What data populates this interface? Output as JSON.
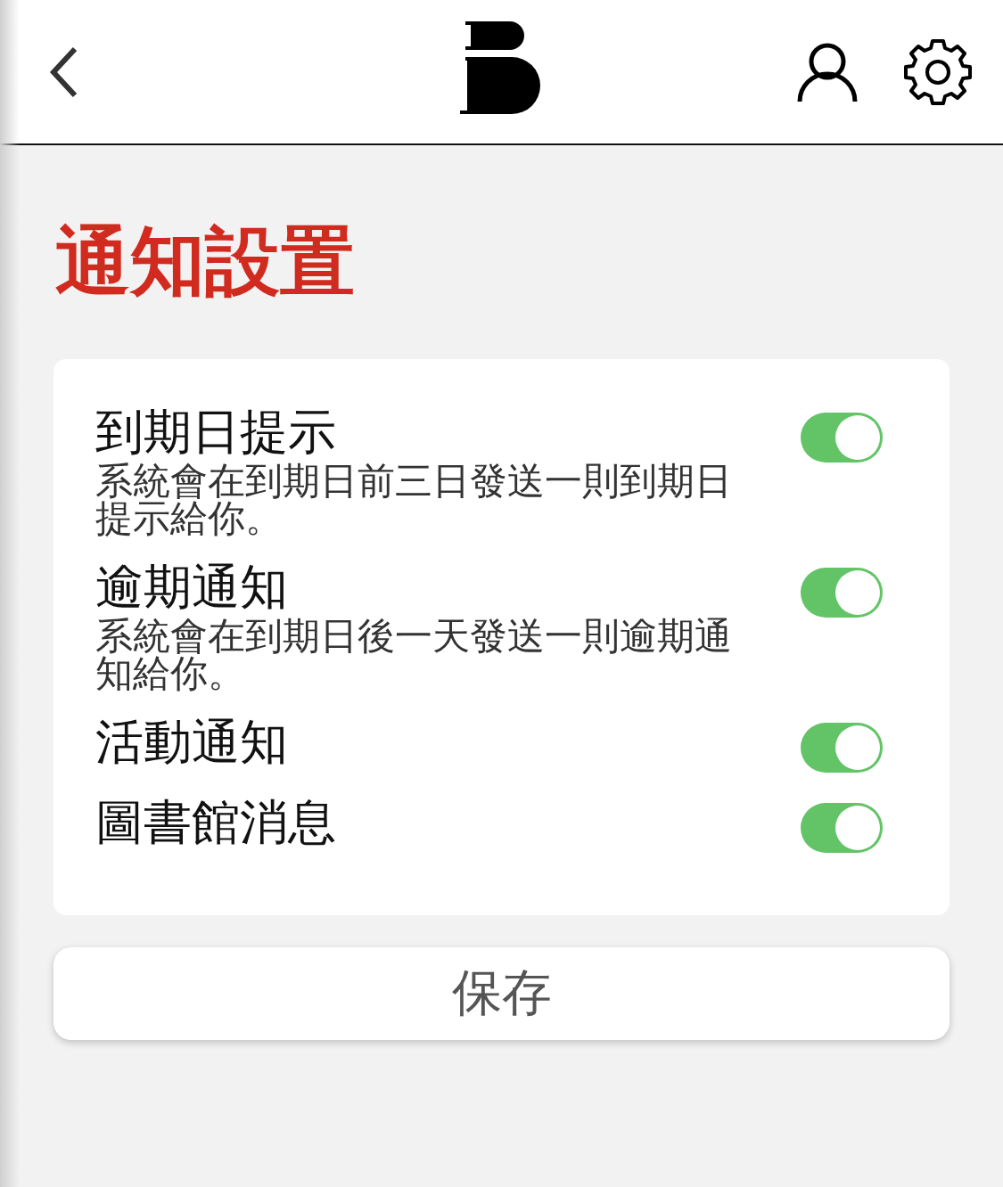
{
  "title": "通知設置",
  "settings": [
    {
      "label": "到期日提示",
      "description": "系統會在到期日前三日發送一則到期日提示給你。",
      "on": true
    },
    {
      "label": "逾期通知",
      "description": "系統會在到期日後一天發送一則逾期通知給你。",
      "on": true
    },
    {
      "label": "活動通知",
      "on": true
    },
    {
      "label": "圖書館消息",
      "on": true
    }
  ],
  "save_button": "保存"
}
